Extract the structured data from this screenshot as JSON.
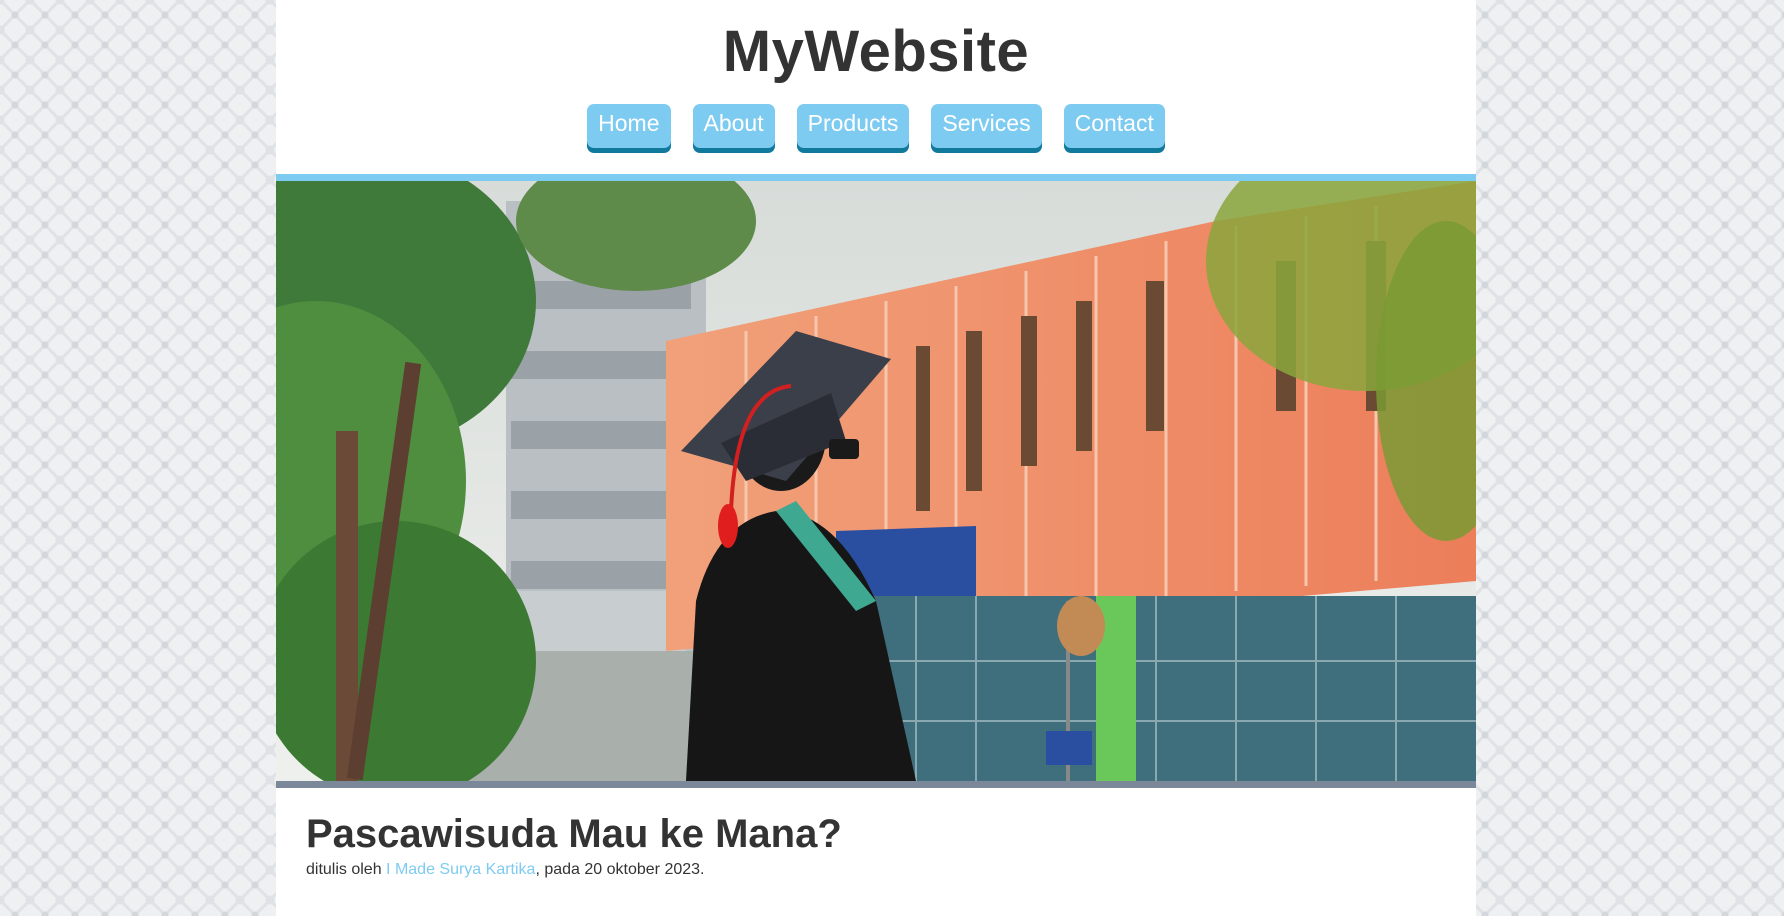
{
  "site": {
    "title": "MyWebsite"
  },
  "nav": {
    "items": [
      {
        "label": "Home"
      },
      {
        "label": "About"
      },
      {
        "label": "Products"
      },
      {
        "label": "Services"
      },
      {
        "label": "Contact"
      }
    ]
  },
  "hero": {
    "subject": "graduate in cap and gown in front of campus building"
  },
  "article": {
    "title": "Pascawisuda Mau ke Mana?",
    "byline_prefix": "ditulis oleh ",
    "author": "I Made Surya Kartika",
    "byline_suffix": ", pada 20 oktober 2023."
  },
  "colors": {
    "accent": "#7ecbf1",
    "accent_dark": "#117a9c",
    "text": "#333333"
  }
}
